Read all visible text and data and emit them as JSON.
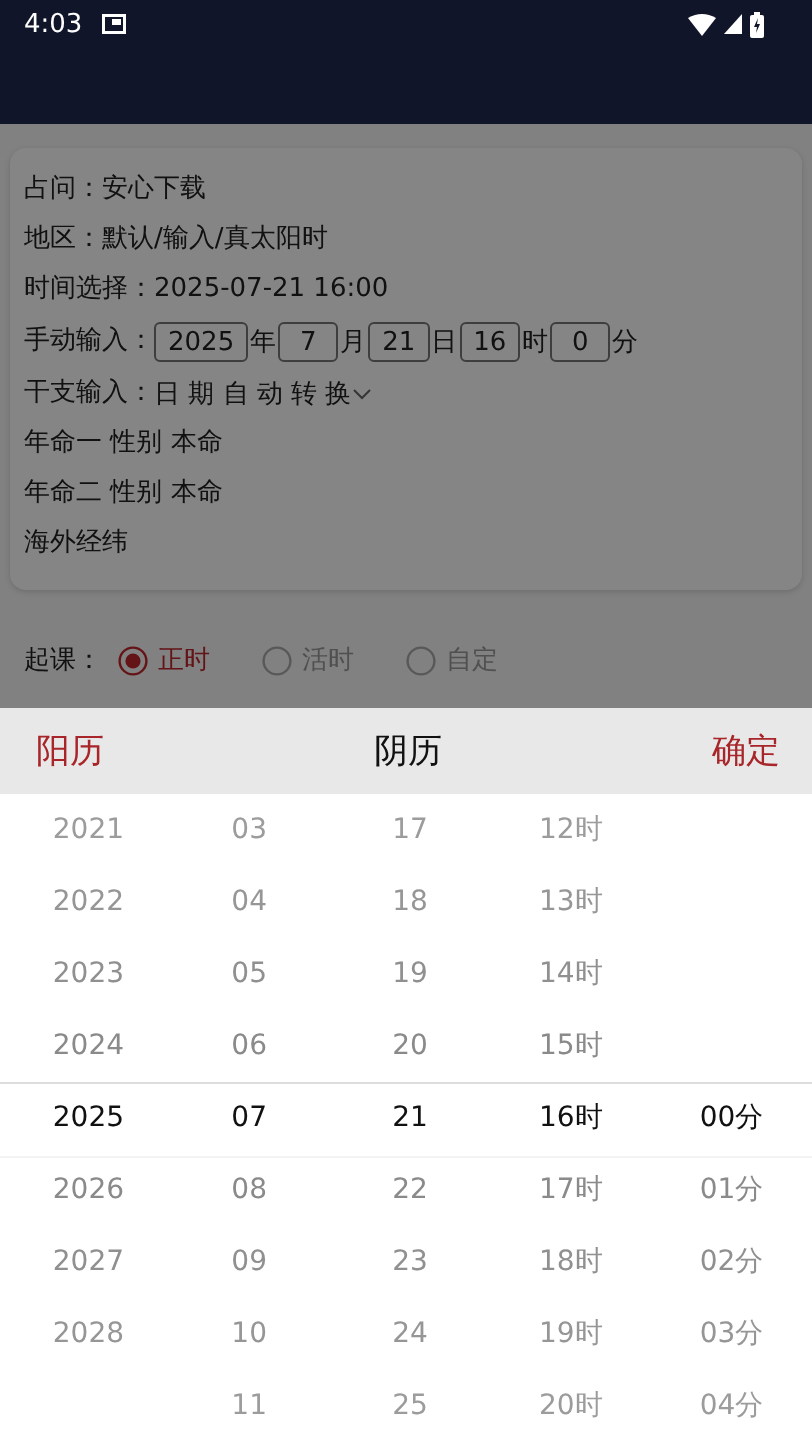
{
  "status_bar": {
    "time": "4:03"
  },
  "card": {
    "lines": [
      {
        "kind": "text",
        "text": "占问：安心下载"
      },
      {
        "kind": "text",
        "text": "地区：默认/输入/真太阳时"
      },
      {
        "kind": "text",
        "text": "时间选择：2025-07-21 16:00"
      },
      {
        "kind": "inputs",
        "label": "手动输入：",
        "fields": [
          {
            "value": "2025",
            "unit": "年"
          },
          {
            "value": "7",
            "unit": "月"
          },
          {
            "value": "21",
            "unit": "日"
          },
          {
            "value": "16",
            "unit": "时"
          },
          {
            "value": "0",
            "unit": "分"
          }
        ]
      },
      {
        "kind": "dropdown",
        "label": "干支输入：",
        "value": "日 期 自 动 转 换"
      },
      {
        "kind": "text",
        "text": "年命一 性别 本命"
      },
      {
        "kind": "text",
        "text": "年命二 性别 本命"
      },
      {
        "kind": "text",
        "text": "海外经纬"
      }
    ]
  },
  "radio_group": {
    "label": "起课：",
    "options": [
      {
        "label": "正时",
        "selected": true
      },
      {
        "label": "活时",
        "selected": false
      },
      {
        "label": "自定",
        "selected": false
      }
    ]
  },
  "picker": {
    "left_button": "阳历",
    "title": "阴历",
    "confirm_button": "确定",
    "columns": [
      {
        "items": [
          {
            "text": "2021",
            "selected": false
          },
          {
            "text": "2022",
            "selected": false
          },
          {
            "text": "2023",
            "selected": false
          },
          {
            "text": "2024",
            "selected": false
          },
          {
            "text": "2025",
            "selected": true
          },
          {
            "text": "2026",
            "selected": false
          },
          {
            "text": "2027",
            "selected": false
          },
          {
            "text": "2028",
            "selected": false
          }
        ]
      },
      {
        "items": [
          {
            "text": "03",
            "selected": false
          },
          {
            "text": "04",
            "selected": false
          },
          {
            "text": "05",
            "selected": false
          },
          {
            "text": "06",
            "selected": false
          },
          {
            "text": "07",
            "selected": true
          },
          {
            "text": "08",
            "selected": false
          },
          {
            "text": "09",
            "selected": false
          },
          {
            "text": "10",
            "selected": false
          },
          {
            "text": "11",
            "selected": false
          }
        ]
      },
      {
        "items": [
          {
            "text": "17",
            "selected": false
          },
          {
            "text": "18",
            "selected": false
          },
          {
            "text": "19",
            "selected": false
          },
          {
            "text": "20",
            "selected": false
          },
          {
            "text": "21",
            "selected": true
          },
          {
            "text": "22",
            "selected": false
          },
          {
            "text": "23",
            "selected": false
          },
          {
            "text": "24",
            "selected": false
          },
          {
            "text": "25",
            "selected": false
          }
        ]
      },
      {
        "items": [
          {
            "text": "12时",
            "selected": false
          },
          {
            "text": "13时",
            "selected": false
          },
          {
            "text": "14时",
            "selected": false
          },
          {
            "text": "15时",
            "selected": false
          },
          {
            "text": "16时",
            "selected": true
          },
          {
            "text": "17时",
            "selected": false
          },
          {
            "text": "18时",
            "selected": false
          },
          {
            "text": "19时",
            "selected": false
          },
          {
            "text": "20时",
            "selected": false
          }
        ]
      },
      {
        "items": [
          {
            "text": "00分",
            "selected": true
          },
          {
            "text": "01分",
            "selected": false
          },
          {
            "text": "02分",
            "selected": false
          },
          {
            "text": "03分",
            "selected": false
          },
          {
            "text": "04分",
            "selected": false
          }
        ]
      }
    ]
  }
}
